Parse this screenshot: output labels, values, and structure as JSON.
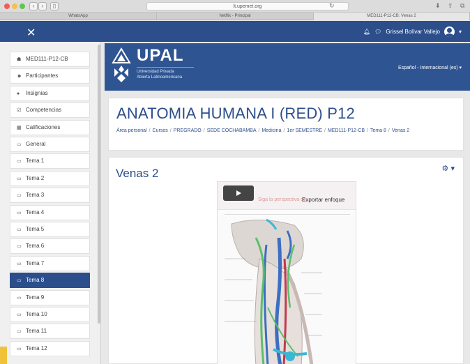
{
  "browser": {
    "address": "lt.upemet.org",
    "tabs": [
      {
        "label": "WhatsApp"
      },
      {
        "label": "Netflix - Principal"
      },
      {
        "label": "MED111-P12-CB: Venas 2"
      }
    ]
  },
  "navbar": {
    "close_icon": "close-icon",
    "user_name": "Grissel Bolívar Vallejo",
    "bell_icon": "bell-icon",
    "chat_icon": "chat-icon"
  },
  "sidebar": {
    "items": [
      {
        "label": "MED111-P12-CB",
        "icon": "graduation-cap-icon",
        "glyph": "☗"
      },
      {
        "label": "Participantes",
        "icon": "users-icon",
        "glyph": "☻"
      },
      {
        "label": "Insignias",
        "icon": "badge-icon",
        "glyph": "●"
      },
      {
        "label": "Competencias",
        "icon": "check-square-icon",
        "glyph": "☑"
      },
      {
        "label": "Calificaciones",
        "icon": "table-icon",
        "glyph": "▦"
      },
      {
        "label": "General",
        "icon": "folder-icon",
        "glyph": "▭"
      },
      {
        "label": "Tema 1",
        "icon": "folder-icon",
        "glyph": "▭"
      },
      {
        "label": "Tema 2",
        "icon": "folder-icon",
        "glyph": "▭"
      },
      {
        "label": "Tema 3",
        "icon": "folder-icon",
        "glyph": "▭"
      },
      {
        "label": "Tema 4",
        "icon": "folder-icon",
        "glyph": "▭"
      },
      {
        "label": "Tema 5",
        "icon": "folder-icon",
        "glyph": "▭"
      },
      {
        "label": "Tema 6",
        "icon": "folder-icon",
        "glyph": "▭"
      },
      {
        "label": "Tema 7",
        "icon": "folder-icon",
        "glyph": "▭"
      },
      {
        "label": "Tema 8",
        "icon": "folder-icon",
        "glyph": "▭",
        "active": true
      },
      {
        "label": "Tema 9",
        "icon": "folder-icon",
        "glyph": "▭"
      },
      {
        "label": "Tema 10",
        "icon": "folder-icon",
        "glyph": "▭"
      },
      {
        "label": "Tema 11",
        "icon": "folder-icon",
        "glyph": "▭"
      },
      {
        "label": "Tema 12",
        "icon": "folder-icon",
        "glyph": "▭"
      }
    ]
  },
  "header": {
    "logo_text": "UPAL",
    "logo_sub1": "Universidad Privada",
    "logo_sub2": "Abierta Latinoamericana",
    "language": "Español - Internacional (es) ▾"
  },
  "course": {
    "title": "ANATOMIA HUMANA I (RED) P12",
    "breadcrumb": [
      "Área personal",
      "Cursos",
      "PREGRADO",
      "SEDE COCHABAMBA",
      "Medicina",
      "1er SEMESTRE",
      "MED111-P12-CB",
      "Tema 8",
      "Venas 2"
    ]
  },
  "main": {
    "page_title": "Venas 2",
    "gear_label": "⚙ ▾",
    "viewer": {
      "faded_text": "Siga la perspectiva de...",
      "export_label": "Exportar enfoque"
    }
  },
  "colors": {
    "brand": "#2c4f8b",
    "header": "#2e5592"
  }
}
